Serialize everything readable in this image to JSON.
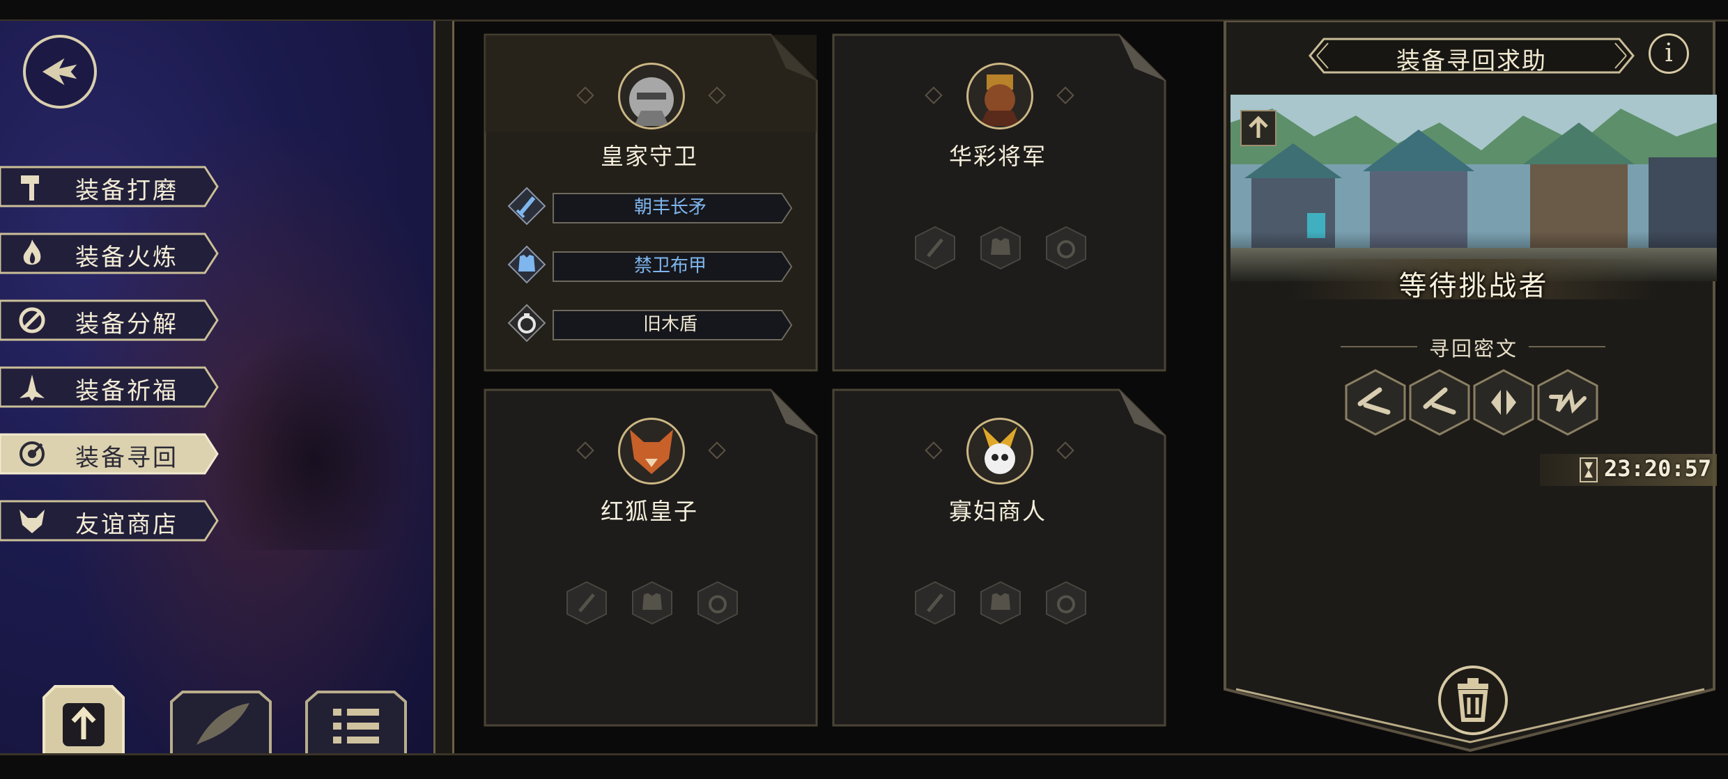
{
  "menu": {
    "items": [
      {
        "label": "装备打磨",
        "icon": "hammer-icon",
        "active": false
      },
      {
        "label": "装备火炼",
        "icon": "flame-icon",
        "active": false
      },
      {
        "label": "装备分解",
        "icon": "shatter-icon",
        "active": false
      },
      {
        "label": "装备祈福",
        "icon": "blessing-icon",
        "active": false
      },
      {
        "label": "装备寻回",
        "icon": "retrieve-icon",
        "active": true
      },
      {
        "label": "友谊商店",
        "icon": "fox-icon",
        "active": false
      }
    ],
    "bottom_buttons": [
      "upload-icon",
      "quill-icon",
      "list-icon"
    ]
  },
  "cards": [
    {
      "name": "皇家守卫",
      "portrait": "armored-knight-avatar",
      "slots": [
        {
          "icon": "sword-icon",
          "text": "朝丰长矛",
          "color": "#7fb6ee"
        },
        {
          "icon": "armor-icon",
          "text": "禁卫布甲",
          "color": "#7fb6ee"
        },
        {
          "icon": "ring-icon",
          "text": "旧木盾",
          "color": "#ede6d2"
        }
      ]
    },
    {
      "name": "华彩将军",
      "portrait": "general-avatar",
      "slots": []
    },
    {
      "name": "红狐皇子",
      "portrait": "red-fox-avatar",
      "slots": []
    },
    {
      "name": "寡妇商人",
      "portrait": "merchant-avatar",
      "slots": []
    }
  ],
  "panel": {
    "title": "装备寻回求助",
    "info": "i",
    "status": "等待挑战者",
    "cipher_title": "寻回密文",
    "runes": [
      "rune-1-icon",
      "rune-2-icon",
      "rune-3-icon",
      "rune-4-icon"
    ],
    "timer": "23:20:57"
  },
  "colors": {
    "accent_gold": "#d6c9a4",
    "rare_blue": "#7fb6ee",
    "menu_bg": "#1b1a4c"
  }
}
